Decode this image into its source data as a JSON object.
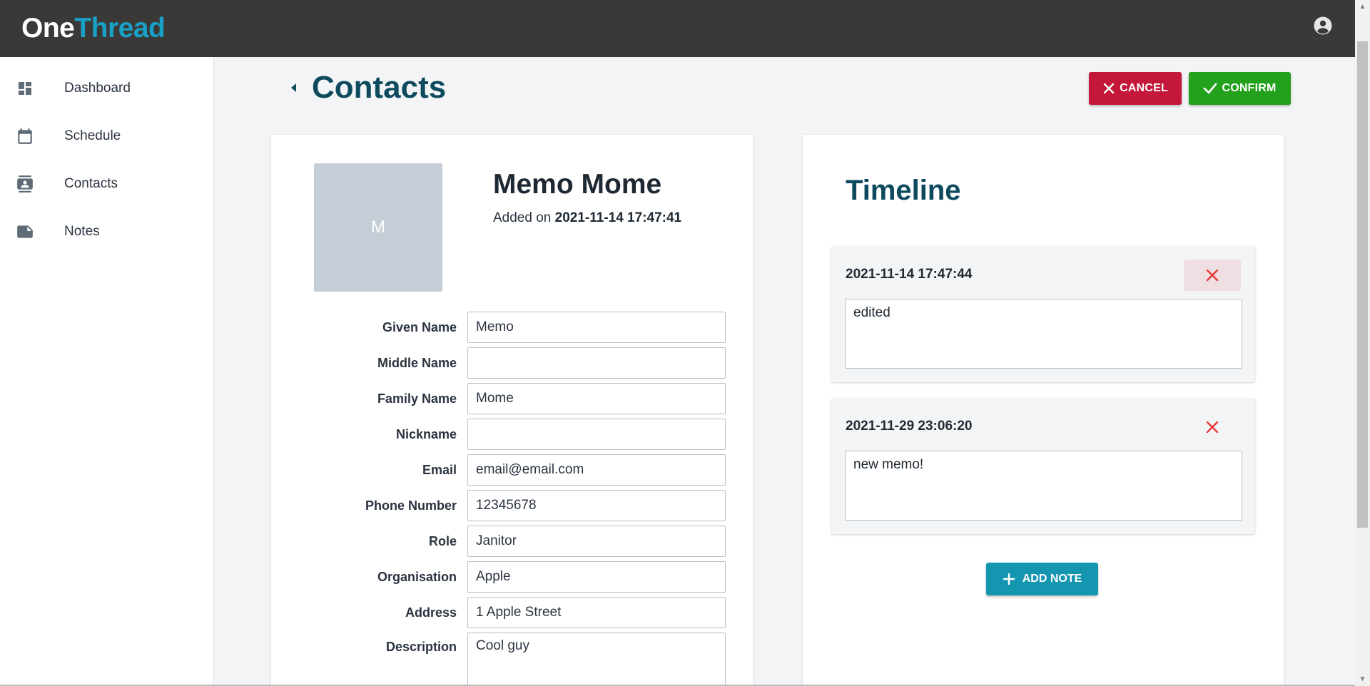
{
  "app": {
    "logo_one": "One",
    "logo_thread": "Thread",
    "account_icon": "account-circle-icon"
  },
  "sidebar": {
    "items": [
      {
        "label": "Dashboard",
        "icon": "dashboard-icon"
      },
      {
        "label": "Schedule",
        "icon": "calendar-icon"
      },
      {
        "label": "Contacts",
        "icon": "contact-card-icon"
      },
      {
        "label": "Notes",
        "icon": "note-icon"
      }
    ]
  },
  "header": {
    "title": "Contacts",
    "cancel_label": "CANCEL",
    "confirm_label": "CONFIRM"
  },
  "contact": {
    "avatar_initial": "M",
    "name": "Memo Mome",
    "added_prefix": "Added on",
    "added_timestamp": "2021-11-14 17:47:41",
    "fields": [
      {
        "label": "Given Name",
        "value": "Memo"
      },
      {
        "label": "Middle Name",
        "value": ""
      },
      {
        "label": "Family Name",
        "value": "Mome"
      },
      {
        "label": "Nickname",
        "value": ""
      },
      {
        "label": "Email",
        "value": "email@email.com"
      },
      {
        "label": "Phone Number",
        "value": "12345678"
      },
      {
        "label": "Role",
        "value": "Janitor"
      },
      {
        "label": "Organisation",
        "value": "Apple"
      },
      {
        "label": "Address",
        "value": "1 Apple Street"
      },
      {
        "label": "Description",
        "value": "Cool guy"
      }
    ]
  },
  "timeline": {
    "title": "Timeline",
    "notes": [
      {
        "timestamp": "2021-11-14 17:47:44",
        "text": "edited"
      },
      {
        "timestamp": "2021-11-29 23:06:20",
        "text": "new memo!"
      }
    ],
    "add_note_label": "ADD NOTE"
  },
  "colors": {
    "brand": "#18a0c7",
    "title": "#0e4a5e",
    "cancel": "#c4173a",
    "confirm": "#23a11d",
    "add_note": "#1596b0",
    "delete_x": "#e53935"
  }
}
